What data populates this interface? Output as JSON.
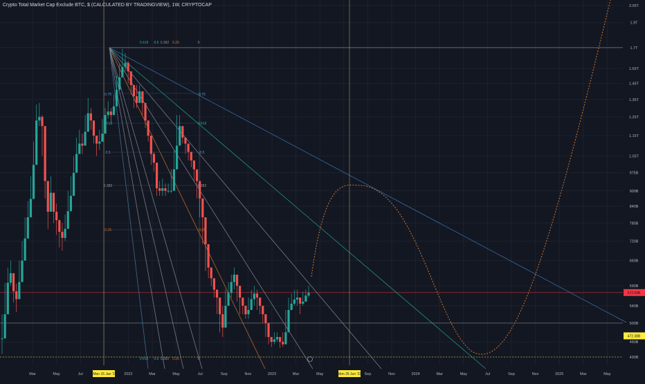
{
  "title": "Crypto Total Market Cap Exclude BTC, $ (CALCULATED BY TRADINGVIEW), 1W, CRYPTOCAP",
  "colors": {
    "background": "#131722",
    "grid": "#1e222d",
    "up": "#26a69a",
    "down": "#ef5350",
    "fan_line": "#3a7bbf",
    "curve": "#d0762f",
    "crosshair": "#b8a45c",
    "highlight_tag": "#ffeb3b",
    "price_tag": "#f23645"
  },
  "chart_data": {
    "type": "candlestick",
    "x_axis_labels": [
      "Mar",
      "May",
      "Jul",
      "Sep",
      "2022",
      "Mar",
      "May",
      "Jul",
      "Sep",
      "Nov",
      "2023",
      "Mar",
      "May",
      "Jul",
      "Sep",
      "Nov",
      "2024",
      "Mar",
      "May",
      "Jul",
      "Sep",
      "Nov",
      "2025",
      "Mar",
      "May"
    ],
    "y_axis_labels": [
      "2.05T",
      "1.9T",
      "1.7T",
      "1.55T",
      "1.45T",
      "1.35T",
      "1.25T",
      "1.15T",
      "1.05T",
      "975B",
      "900B",
      "840B",
      "780B",
      "720B",
      "660B",
      "590B",
      "540B",
      "500B",
      "460B",
      "430B"
    ],
    "ylim": [
      420,
      2100
    ],
    "scale": "log",
    "price_tag": "572.59B",
    "crosshair_y_tag": "472.38B",
    "crosshair_x_tag": "Mon 15 Jan '2",
    "crosshair_x_tag_2": "Mon 26 Jun '23",
    "fib_top_labels": [
      "0.618",
      "0.5",
      "0.382",
      "0.25",
      "0"
    ],
    "fib_bottom_labels": [
      "0.618",
      "0.5",
      "0.382",
      "0.25",
      "0"
    ],
    "fib_left_labels": [
      "0.75",
      "0.618",
      "0.5",
      "0.382",
      "0.25"
    ],
    "fib_right_labels": [
      "0.75",
      "0.618",
      "0.5",
      "0.382",
      "0.25"
    ],
    "level_lines": [
      "1.7T",
      "572.59B",
      "500B",
      "430B"
    ],
    "candles": [
      [
        467,
        467,
        520,
        436
      ],
      [
        520,
        520,
        598,
        500
      ],
      [
        598,
        598,
        640,
        560
      ],
      [
        624,
        624,
        660,
        590
      ],
      [
        576,
        576,
        612,
        548
      ],
      [
        556,
        556,
        596,
        525
      ],
      [
        600,
        600,
        660,
        580
      ],
      [
        660,
        660,
        720,
        635
      ],
      [
        728,
        728,
        800,
        700
      ],
      [
        800,
        800,
        860,
        770
      ],
      [
        868,
        868,
        960,
        840
      ],
      [
        1010,
        1010,
        1120,
        980
      ],
      [
        1230,
        1230,
        1320,
        1180
      ],
      [
        1250,
        1250,
        1330,
        1200
      ],
      [
        1200,
        1200,
        1260,
        1050
      ],
      [
        940,
        940,
        1000,
        870
      ],
      [
        820,
        820,
        880,
        760
      ],
      [
        892,
        892,
        960,
        840
      ],
      [
        820,
        820,
        870,
        780
      ],
      [
        790,
        790,
        850,
        740
      ],
      [
        750,
        750,
        790,
        700
      ],
      [
        730,
        730,
        780,
        690
      ],
      [
        760,
        760,
        810,
        720
      ],
      [
        822,
        822,
        900,
        790
      ],
      [
        880,
        880,
        960,
        850
      ],
      [
        975,
        975,
        1050,
        940
      ],
      [
        1060,
        1060,
        1140,
        1020
      ],
      [
        1110,
        1110,
        1180,
        1070
      ],
      [
        1100,
        1100,
        1160,
        1060
      ],
      [
        1170,
        1170,
        1260,
        1140
      ],
      [
        1270,
        1270,
        1360,
        1230
      ],
      [
        1230,
        1230,
        1300,
        1180
      ],
      [
        1150,
        1150,
        1200,
        1110
      ],
      [
        1110,
        1110,
        1150,
        1050
      ],
      [
        1120,
        1120,
        1180,
        1080
      ],
      [
        1160,
        1160,
        1240,
        1130
      ],
      [
        1260,
        1260,
        1300,
        1220
      ],
      [
        1280,
        1280,
        1340,
        1240
      ],
      [
        1260,
        1260,
        1300,
        1220
      ],
      [
        1310,
        1310,
        1380,
        1280
      ],
      [
        1410,
        1410,
        1500,
        1390
      ],
      [
        1490,
        1490,
        1580,
        1460
      ],
      [
        1560,
        1560,
        1690,
        1530
      ],
      [
        1590,
        1590,
        1660,
        1530
      ],
      [
        1530,
        1530,
        1600,
        1450
      ],
      [
        1440,
        1440,
        1500,
        1380
      ],
      [
        1370,
        1370,
        1420,
        1300
      ],
      [
        1330,
        1330,
        1440,
        1300
      ],
      [
        1400,
        1400,
        1440,
        1340
      ],
      [
        1330,
        1330,
        1370,
        1260
      ],
      [
        1230,
        1230,
        1290,
        1190
      ],
      [
        1150,
        1150,
        1210,
        1120
      ],
      [
        1060,
        1060,
        1110,
        1010
      ],
      [
        1020,
        1020,
        1070,
        980
      ],
      [
        910,
        910,
        960,
        880
      ],
      [
        900,
        900,
        940,
        880
      ],
      [
        910,
        910,
        950,
        880
      ],
      [
        900,
        900,
        930,
        880
      ],
      [
        900,
        900,
        930,
        890
      ],
      [
        900,
        900,
        990,
        890
      ],
      [
        990,
        990,
        1080,
        960
      ],
      [
        1100,
        1100,
        1260,
        1070
      ],
      [
        1200,
        1200,
        1260,
        1140
      ],
      [
        1140,
        1140,
        1180,
        1110
      ],
      [
        1110,
        1110,
        1140,
        1060
      ],
      [
        1070,
        1070,
        1100,
        1030
      ],
      [
        1030,
        1030,
        1060,
        1000
      ],
      [
        990,
        990,
        1010,
        940
      ],
      [
        940,
        940,
        960,
        870
      ],
      [
        870,
        870,
        890,
        800
      ],
      [
        800,
        800,
        820,
        710
      ],
      [
        710,
        710,
        730,
        630
      ],
      [
        640,
        640,
        660,
        610
      ],
      [
        610,
        610,
        640,
        590
      ],
      [
        580,
        580,
        610,
        560
      ],
      [
        560,
        560,
        580,
        520
      ],
      [
        520,
        520,
        540,
        480
      ],
      [
        490,
        490,
        540,
        470
      ],
      [
        540,
        540,
        580,
        520
      ],
      [
        572,
        572,
        600,
        540
      ],
      [
        600,
        600,
        620,
        560
      ],
      [
        620,
        620,
        640,
        580
      ],
      [
        590,
        590,
        610,
        550
      ],
      [
        560,
        560,
        580,
        520
      ],
      [
        540,
        540,
        560,
        520
      ],
      [
        520,
        520,
        540,
        510
      ],
      [
        530,
        530,
        560,
        510
      ],
      [
        556,
        556,
        580,
        530
      ],
      [
        570,
        570,
        590,
        540
      ],
      [
        560,
        560,
        580,
        530
      ],
      [
        540,
        540,
        560,
        520
      ],
      [
        520,
        520,
        540,
        500
      ],
      [
        500,
        500,
        520,
        470
      ],
      [
        470,
        470,
        490,
        455
      ],
      [
        460,
        460,
        470,
        450
      ],
      [
        465,
        465,
        480,
        455
      ],
      [
        470,
        470,
        480,
        460
      ],
      [
        460,
        460,
        470,
        448
      ],
      [
        455,
        455,
        480,
        450
      ],
      [
        480,
        480,
        530,
        470
      ],
      [
        530,
        530,
        560,
        510
      ],
      [
        545,
        545,
        570,
        530
      ],
      [
        555,
        555,
        580,
        540
      ],
      [
        560,
        560,
        580,
        540
      ],
      [
        545,
        545,
        560,
        520
      ],
      [
        550,
        550,
        575,
        540
      ],
      [
        565,
        565,
        580,
        550
      ],
      [
        572,
        572,
        590,
        560
      ]
    ]
  }
}
